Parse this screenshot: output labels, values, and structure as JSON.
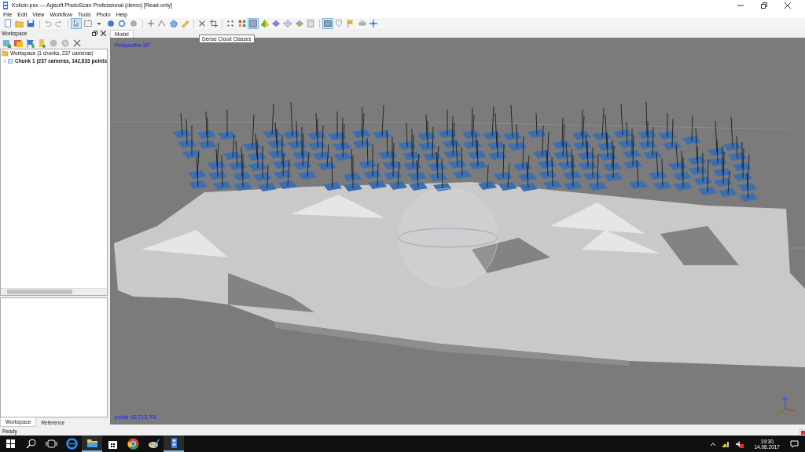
{
  "window": {
    "title": "Kolicin.psx — Agisoft PhotoScan Professional (demo) [Read-only]"
  },
  "menu": [
    "File",
    "Edit",
    "View",
    "Workflow",
    "Tools",
    "Photo",
    "Help"
  ],
  "toolbar": [
    [
      {
        "kind": "new",
        "selected": false
      },
      {
        "kind": "open",
        "selected": false
      },
      {
        "kind": "save",
        "selected": false
      }
    ],
    [
      {
        "kind": "undo",
        "selected": false
      },
      {
        "kind": "redo",
        "selected": false
      }
    ],
    [
      {
        "kind": "pointer",
        "selected": true
      },
      {
        "kind": "rectselect",
        "selected": false
      },
      {
        "kind": "caret",
        "selected": false
      },
      {
        "kind": "navigate",
        "selected": false
      },
      {
        "kind": "rotate",
        "selected": false
      },
      {
        "kind": "resize",
        "selected": false
      }
    ],
    [
      {
        "kind": "plus",
        "selected": false
      },
      {
        "kind": "polyline",
        "selected": false
      },
      {
        "kind": "polygon",
        "selected": false
      },
      {
        "kind": "ruler",
        "selected": false
      }
    ],
    [
      {
        "kind": "delete",
        "selected": false
      },
      {
        "kind": "crop",
        "selected": false
      }
    ],
    [
      {
        "kind": "points",
        "selected": false
      },
      {
        "kind": "colorpoints",
        "selected": false
      },
      {
        "kind": "classes",
        "selected": true
      },
      {
        "kind": "shaded",
        "selected": false
      },
      {
        "kind": "solid",
        "selected": false
      },
      {
        "kind": "wire",
        "selected": false
      },
      {
        "kind": "textured",
        "selected": false
      },
      {
        "kind": "tiled",
        "selected": false
      }
    ],
    [
      {
        "kind": "cameras",
        "selected": true
      },
      {
        "kind": "shapes",
        "selected": false
      },
      {
        "kind": "markers",
        "selected": false
      },
      {
        "kind": "print",
        "selected": false
      },
      {
        "kind": "move",
        "selected": false
      }
    ]
  ],
  "tooltip": "Dense Cloud Classes",
  "workspace_panel": {
    "title": "Workspace",
    "tools": [
      {
        "kind": "add-chunk"
      },
      {
        "kind": "add-photos"
      },
      {
        "kind": "add-markers"
      },
      {
        "kind": "add-folder"
      },
      {
        "kind": "enable"
      },
      {
        "kind": "disable"
      },
      {
        "kind": "remove"
      }
    ],
    "tree": [
      {
        "label": "Workspace (1 chunks, 237 cameras)",
        "children": [
          {
            "label": "Chunk 1 (237 cameras, 142,833 points",
            "expanded": false
          }
        ]
      }
    ],
    "tabs": [
      {
        "label": "Workspace",
        "selected": true
      },
      {
        "label": "Reference",
        "selected": false
      }
    ]
  },
  "viewport": {
    "tabs": [
      {
        "label": "Model",
        "selected": true
      }
    ],
    "projection": "Perspective 30°",
    "points": "points: 62,713,700"
  },
  "status_bar": "Ready",
  "taskbar": {
    "apps": [
      {
        "kind": "start",
        "selected": false
      },
      {
        "kind": "search",
        "selected": false
      },
      {
        "kind": "taskview",
        "selected": false
      },
      {
        "kind": "edge",
        "selected": false
      },
      {
        "kind": "explorer",
        "selected": true
      },
      {
        "kind": "store",
        "selected": false
      },
      {
        "kind": "chrome",
        "selected": false
      },
      {
        "kind": "paint",
        "selected": false
      },
      {
        "kind": "photoscan",
        "selected": true
      }
    ],
    "time": "19:30",
    "date": "14.08.2017"
  }
}
